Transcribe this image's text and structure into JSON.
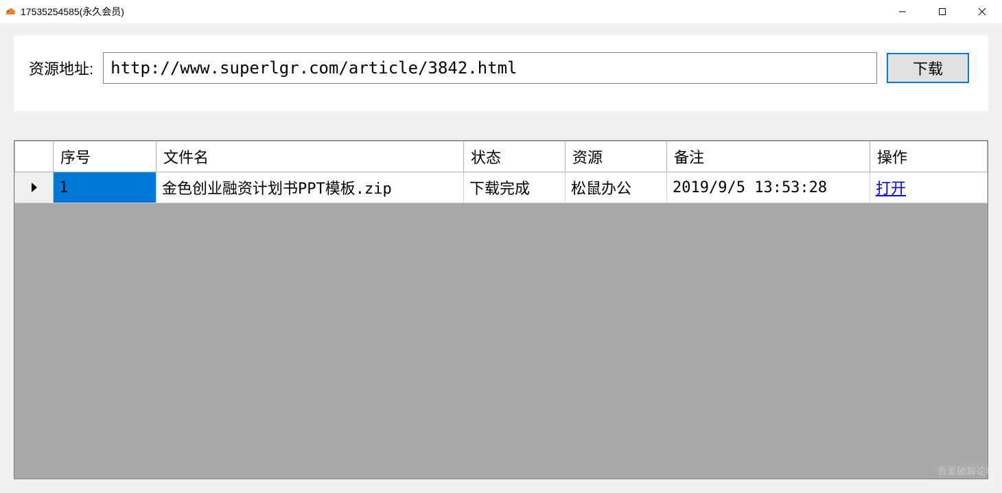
{
  "window": {
    "title": "17535254585(永久会员)"
  },
  "toolbar": {
    "url_label": "资源地址:",
    "url_value": "http://www.superlgr.com/article/3842.html",
    "download_label": "下载"
  },
  "grid": {
    "headers": {
      "seq": "序号",
      "filename": "文件名",
      "status": "状态",
      "source": "资源",
      "remark": "备注",
      "action": "操作"
    },
    "rows": [
      {
        "seq": "1",
        "filename": "金色创业融资计划书PPT模板.zip",
        "status": "下载完成",
        "source": "松鼠办公",
        "remark": "2019/9/5 13:53:28",
        "action": "打开"
      }
    ]
  },
  "watermark": {
    "line1": "吾爱破解论坛",
    "line2": "www.52pojie.cn"
  }
}
